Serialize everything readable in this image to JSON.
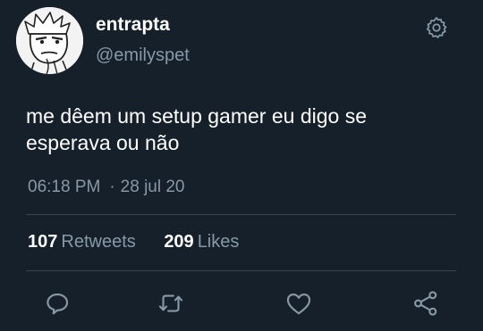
{
  "user": {
    "display_name": "entrapta",
    "handle": "@emilyspet",
    "avatar_icon": "avatar-cartoon-face"
  },
  "tweet": {
    "line1": "me dêem um setup gamer eu digo se",
    "line2": "esperava ou não",
    "time": "06:18 PM",
    "separator": "·",
    "date": "28 jul 20"
  },
  "stats": {
    "retweets_count": "107",
    "retweets_label": "Retweets",
    "likes_count": "209",
    "likes_label": "Likes"
  },
  "actions": [
    "reply-icon",
    "retweet-icon",
    "like-icon",
    "share-icon"
  ],
  "colors": {
    "background": "#15202b",
    "text_primary": "#ffffff",
    "text_secondary": "#8899a6",
    "divider": "#38444d"
  }
}
